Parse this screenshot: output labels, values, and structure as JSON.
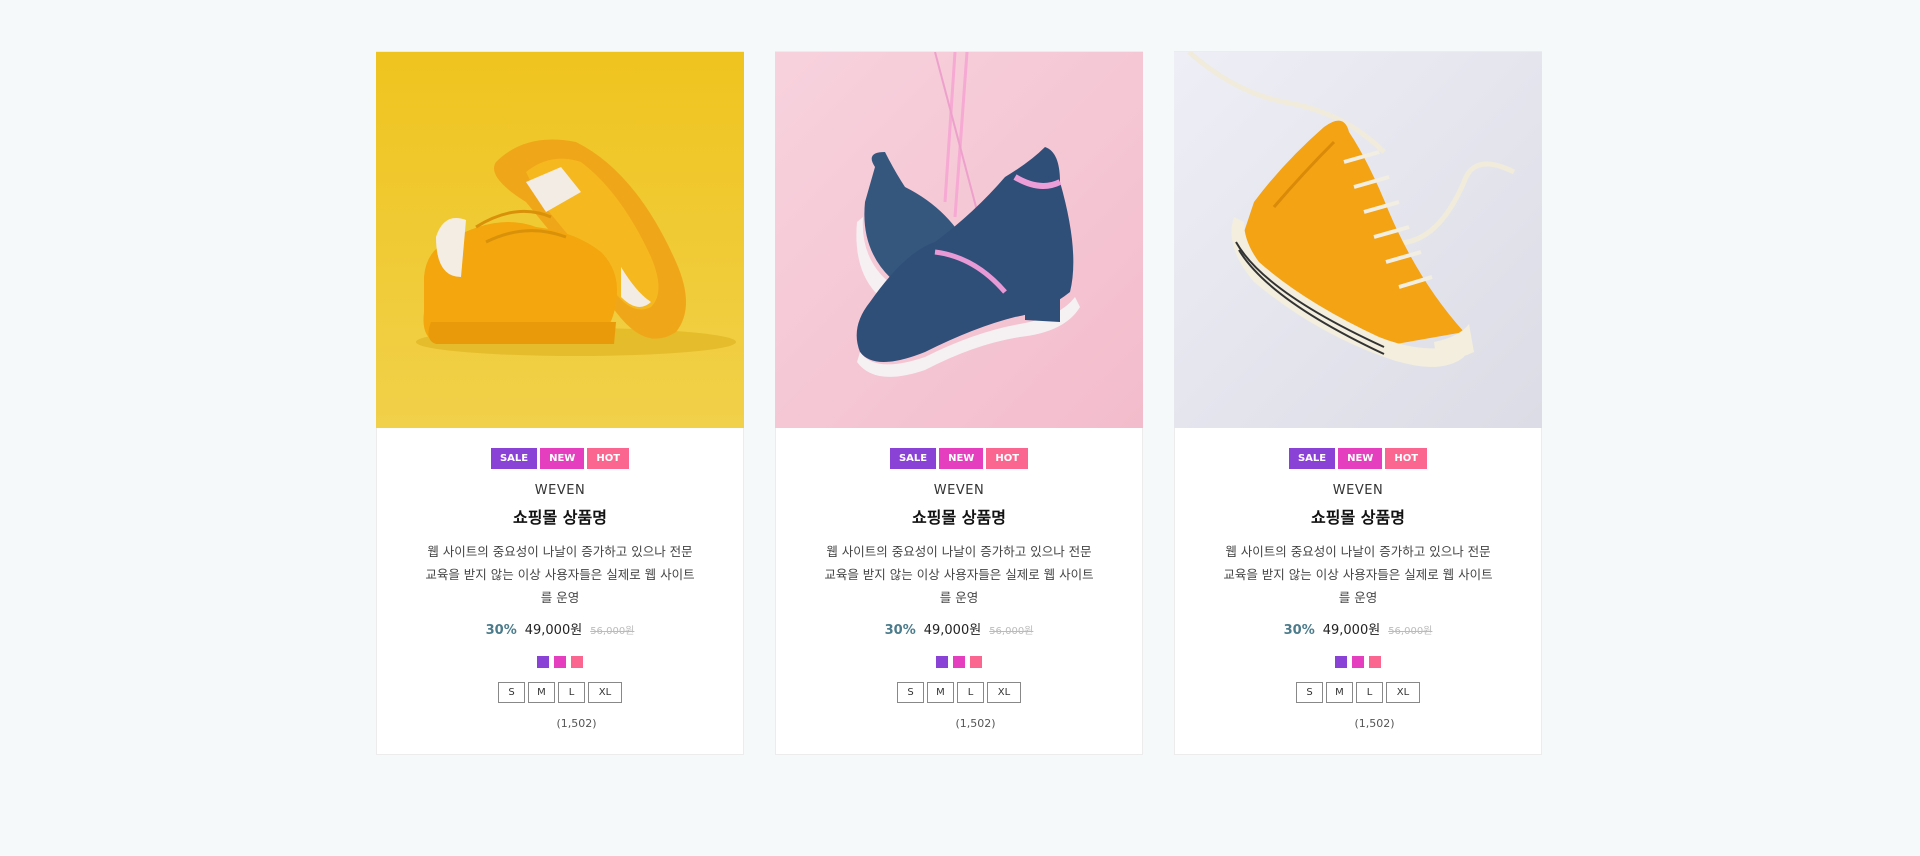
{
  "products": [
    {
      "badges": [
        "SALE",
        "NEW",
        "HOT"
      ],
      "brand": "WEVEN",
      "name": "쇼핑몰 상품명",
      "description": "웹 사이트의 중요성이 나날이 증가하고 있으나 전문교육을 받지 않는 이상 사용자들은 실제로 웹 사이트를 운영",
      "discount": "30%",
      "price": "49,000원",
      "original_price": "56,000원",
      "colors": [
        "#8a42d6",
        "#e53fbf",
        "#fb6690"
      ],
      "sizes": [
        "S",
        "M",
        "L",
        "XL"
      ],
      "reviews": "(1,502)",
      "image": "yellow-sneaker-image"
    },
    {
      "badges": [
        "SALE",
        "NEW",
        "HOT"
      ],
      "brand": "WEVEN",
      "name": "쇼핑몰 상품명",
      "description": "웹 사이트의 중요성이 나날이 증가하고 있으나 전문교육을 받지 않는 이상 사용자들은 실제로 웹 사이트를 운영",
      "discount": "30%",
      "price": "49,000원",
      "original_price": "56,000원",
      "colors": [
        "#8a42d6",
        "#e53fbf",
        "#fb6690"
      ],
      "sizes": [
        "S",
        "M",
        "L",
        "XL"
      ],
      "reviews": "(1,502)",
      "image": "navy-pink-sneakers-image"
    },
    {
      "badges": [
        "SALE",
        "NEW",
        "HOT"
      ],
      "brand": "WEVEN",
      "name": "쇼핑몰 상품명",
      "description": "웹 사이트의 중요성이 나날이 증가하고 있으나 전문교육을 받지 않는 이상 사용자들은 실제로 웹 사이트를 운영",
      "discount": "30%",
      "price": "49,000원",
      "original_price": "56,000원",
      "colors": [
        "#8a42d6",
        "#e53fbf",
        "#fb6690"
      ],
      "sizes": [
        "S",
        "M",
        "L",
        "XL"
      ],
      "reviews": "(1,502)",
      "image": "orange-hightop-image"
    }
  ]
}
